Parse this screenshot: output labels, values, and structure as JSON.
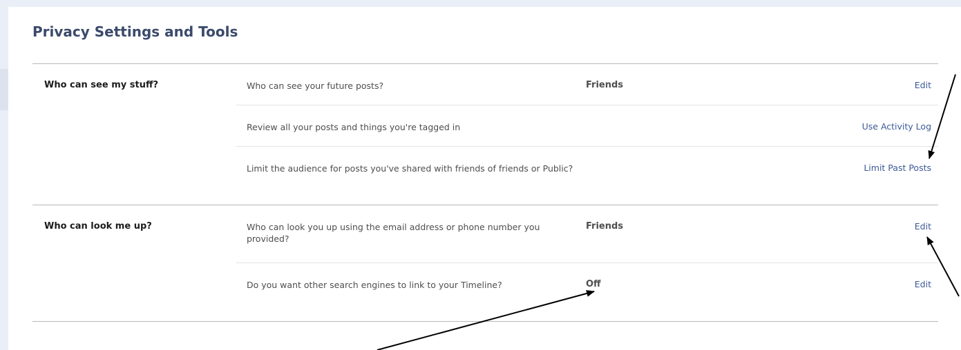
{
  "page": {
    "title": "Privacy Settings and Tools"
  },
  "sections": [
    {
      "label": "Who can see my stuff?",
      "rows": [
        {
          "question": "Who can see your future posts?",
          "value": "Friends",
          "action": "Edit"
        },
        {
          "question": "Review all your posts and things you're tagged in",
          "value": "",
          "action": "Use Activity Log"
        },
        {
          "question": "Limit the audience for posts you've shared with friends of friends or Public?",
          "value": "",
          "action": "Limit Past Posts"
        }
      ]
    },
    {
      "label": "Who can look me up?",
      "rows": [
        {
          "question": "Who can look you up using the email address or phone number you provided?",
          "value": "Friends",
          "action": "Edit"
        },
        {
          "question": "Do you want other search engines to link to your Timeline?",
          "value": "Off",
          "action": "Edit"
        }
      ]
    }
  ],
  "colors": {
    "link": "#3b5998",
    "title": "#3b4a6b",
    "background": "#e9eef7"
  }
}
